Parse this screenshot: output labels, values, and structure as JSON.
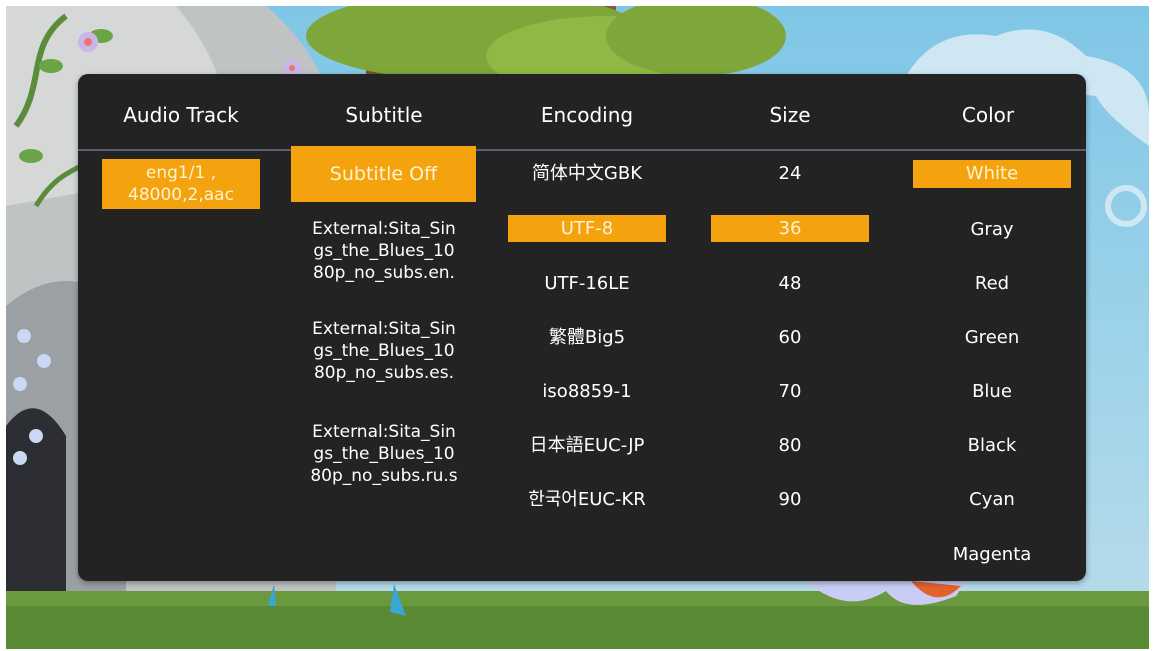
{
  "columns": {
    "audio": {
      "header": "Audio Track",
      "items": [
        {
          "label": "eng1/1 ,\n48000,2,aac",
          "selected": true
        }
      ]
    },
    "subtitle": {
      "header": "Subtitle",
      "items": [
        {
          "label": "Subtitle Off",
          "selected": true
        },
        {
          "label": "External:Sita_Sin\ngs_the_Blues_10\n80p_no_subs.en.",
          "selected": false
        },
        {
          "label": "External:Sita_Sin\ngs_the_Blues_10\n80p_no_subs.es.",
          "selected": false
        },
        {
          "label": "External:Sita_Sin\ngs_the_Blues_10\n80p_no_subs.ru.s",
          "selected": false
        }
      ]
    },
    "encoding": {
      "header": "Encoding",
      "items": [
        {
          "label": "简体中文GBK",
          "selected": false
        },
        {
          "label": "UTF-8",
          "selected": true
        },
        {
          "label": "UTF-16LE",
          "selected": false
        },
        {
          "label": "繁體Big5",
          "selected": false
        },
        {
          "label": "iso8859-1",
          "selected": false
        },
        {
          "label": "日本語EUC-JP",
          "selected": false
        },
        {
          "label": "한국어EUC-KR",
          "selected": false
        }
      ]
    },
    "size": {
      "header": "Size",
      "items": [
        {
          "label": "24",
          "selected": false
        },
        {
          "label": "36",
          "selected": true
        },
        {
          "label": "48",
          "selected": false
        },
        {
          "label": "60",
          "selected": false
        },
        {
          "label": "70",
          "selected": false
        },
        {
          "label": "80",
          "selected": false
        },
        {
          "label": "90",
          "selected": false
        }
      ]
    },
    "color": {
      "header": "Color",
      "items": [
        {
          "label": "White",
          "selected": true
        },
        {
          "label": "Gray",
          "selected": false
        },
        {
          "label": "Red",
          "selected": false
        },
        {
          "label": "Green",
          "selected": false
        },
        {
          "label": "Blue",
          "selected": false
        },
        {
          "label": "Black",
          "selected": false
        },
        {
          "label": "Cyan",
          "selected": false
        },
        {
          "label": "Magenta",
          "selected": false
        }
      ]
    }
  },
  "colors": {
    "panel_bg": "#232323",
    "highlight": "#f4a30e",
    "divider": "#5a5e70",
    "text": "#ffffff"
  }
}
